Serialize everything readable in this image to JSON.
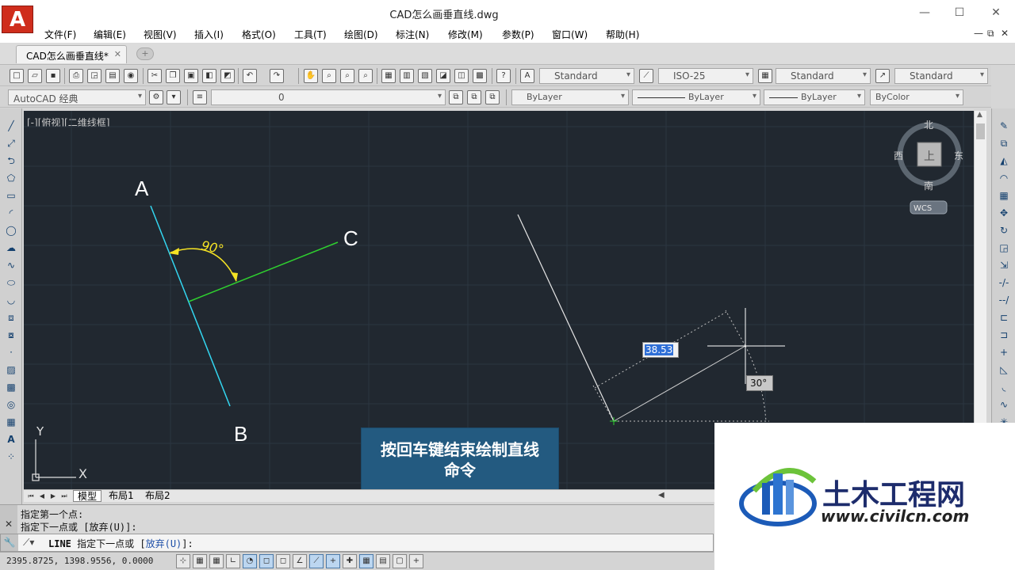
{
  "window": {
    "title": "CAD怎么画垂直线.dwg",
    "logo_letter": "A",
    "controls": [
      "—",
      "☐",
      "✕"
    ]
  },
  "menu": {
    "items": [
      "文件(F)",
      "编辑(E)",
      "视图(V)",
      "插入(I)",
      "格式(O)",
      "工具(T)",
      "绘图(D)",
      "标注(N)",
      "修改(M)",
      "参数(P)",
      "窗口(W)",
      "帮助(H)"
    ],
    "mdi_controls": [
      "—",
      "⧉",
      "✕"
    ]
  },
  "tabs": {
    "doc_tab": "CAD怎么画垂直线*",
    "close": "✕",
    "new_tab": "+"
  },
  "toolbar1": {
    "text_style": "Standard",
    "dim_style": "ISO-25",
    "table_style": "Standard",
    "multileader_style": "Standard"
  },
  "toolbar2": {
    "workspace": "AutoCAD 经典",
    "layer": "0",
    "color": "ByLayer",
    "linetype": "ByLayer",
    "lineweight": "ByLayer",
    "plotstyle": "ByColor"
  },
  "viewport": {
    "label": "[-][俯视][二维线框]",
    "point_labels": {
      "a": "A",
      "b": "B",
      "c": "C"
    },
    "angle_label": "90°",
    "dynamic_length": "38.53",
    "dynamic_angle": "30°",
    "ucs_x": "X",
    "ucs_y": "Y"
  },
  "viewcube": {
    "north": "北",
    "south": "南",
    "east": "东",
    "west": "西",
    "face": "上",
    "wcs": "WCS"
  },
  "caption": {
    "line1": "按回车键结束绘制直线",
    "line2": "命令"
  },
  "layout_tabs": [
    "模型",
    "布局1",
    "布局2"
  ],
  "command": {
    "history": [
      "指定第一个点:",
      "指定下一点或 [放弃(U)]:"
    ],
    "current_cmd": "LINE",
    "current_prompt": "指定下一点或 [",
    "current_option": "放弃(U)",
    "current_end": "]:"
  },
  "status": {
    "coordinates": "2395.8725, 1398.9556, 0.0000"
  },
  "watermark": {
    "title": "土木工程网",
    "url": "www.civilcn.com"
  },
  "colors": {
    "canvas_bg": "#212830",
    "line_ab": "#33d6f0",
    "line_c": "#2fcf2f",
    "angle": "#f5e324",
    "caption_bg": "#235a80"
  }
}
